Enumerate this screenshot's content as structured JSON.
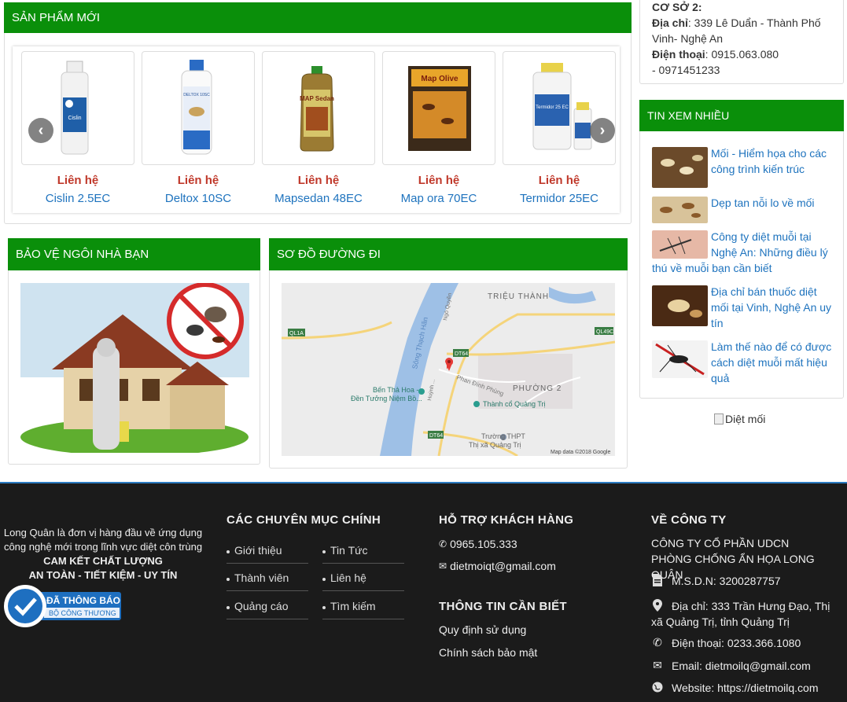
{
  "products_section": {
    "title": "SẢN PHẨM MỚI",
    "items": [
      {
        "price": "Liên hệ",
        "name": "Cislin 2.5EC",
        "label": "Cislin"
      },
      {
        "price": "Liên hệ",
        "name": "Deltox 10SC",
        "label": "DELTOX 10SC"
      },
      {
        "price": "Liên hệ",
        "name": "Mapsedan 48EC",
        "label": "MAP Sedan"
      },
      {
        "price": "Liên hệ",
        "name": "Map ora 70EC",
        "label": "Map Olive"
      },
      {
        "price": "Liên hệ",
        "name": "Termidor 25EC",
        "label": "Termidor 25 EC"
      }
    ]
  },
  "office": {
    "heading": "CƠ SỞ 2:",
    "address_label": "Địa chỉ",
    "address": ": 339 Lê Duẩn - Thành Phố Vinh- Nghệ An",
    "phone_label": "Điện thoại",
    "phone": ": 0915.063.080",
    "phone2": "- 0971451233"
  },
  "most_viewed": {
    "title": "TIN XEM NHIỀU",
    "items": [
      {
        "title": "Mối - Hiểm họa cho các công trình kiến trúc"
      },
      {
        "title": "Dẹp tan nỗi lo về mối"
      },
      {
        "title": "Công ty diệt muỗi tại Nghệ An: Những điều lý thú về muỗi bạn cần biết"
      },
      {
        "title": "Địa chỉ bán thuốc diệt mối tại Vinh, Nghệ An uy tín"
      },
      {
        "title": "Làm thế nào để có được cách diệt muỗi mất hiệu quả"
      }
    ]
  },
  "banner_alt": "Diệt mối",
  "protect_section": {
    "title": "BẢO VỆ NGÔI NHÀ BẠN"
  },
  "map_section": {
    "title": "SƠ ĐỒ ĐƯỜNG ĐI",
    "labels": {
      "area1": "TRIỆU THÀNH",
      "area2": "PHƯỜNG 2",
      "river": "Sông Thạch Hãn",
      "place1": "Bến Thả Hoa -",
      "place1b": "Đền Tưởng Niệm Bồ...",
      "place2": "Thành cổ Quảng Trị",
      "place3": "Trường THPT",
      "place3b": "Thị xã Quảng Trị",
      "street": "Phan Đình Phùng",
      "street2": "Ngô Quyền",
      "street3": "Huỳnh ...",
      "road1": "QL1A",
      "road2": "DT64",
      "road3": "QL49C",
      "road4": "DT64",
      "copyright": "Map data ©2018 Google"
    }
  },
  "footer": {
    "about_line1": "Long Quân là đơn vị hàng đầu về ứng dụng",
    "about_line2": "công nghệ mới trong lĩnh vực diệt côn trùng",
    "about_line3": "CAM KẾT CHẤT LƯỢNG",
    "about_line4": "AN TOÀN - TIẾT KIỆM - UY TÍN",
    "badge_main": "ĐÃ THÔNG BÁO",
    "badge_sub": "BỘ CÔNG THƯƠNG",
    "categories_title": "CÁC CHUYÊN MỤC CHÍNH",
    "categories": [
      "Giới thiệu",
      "Tin Tức",
      "Thành viên",
      "Liên hệ",
      "Quảng cáo",
      "Tìm kiếm"
    ],
    "support_title": "HỖ TRỢ KHÁCH HÀNG",
    "support_phone": "0965.105.333",
    "support_email": "dietmoiqt@gmail.com",
    "info_title": "THÔNG TIN CẦN BIẾT",
    "info_links": [
      "Quy định sử dụng",
      "Chính sách bảo mật"
    ],
    "company_title": "VỀ CÔNG TY",
    "company_name": "CÔNG TY CỔ PHẦN UDCN PHÒNG CHỐNG ẨN HỌA LONG QUÂN",
    "tax": "M.S.D.N: 3200287757",
    "address": "Địa chỉ: 333 Trần Hưng Đạo, Thị xã Quảng Trị, tỉnh Quảng Trị",
    "phone": "Điện thoại: 0233.366.1080",
    "email": "Email: dietmoilq@gmail.com",
    "website": "Website: https://dietmoilq.com"
  },
  "colors": {
    "brand_green": "#0a8f0a",
    "link_blue": "#1e73be",
    "price_red": "#c0392b",
    "footer_bg": "#1b1b1b"
  }
}
